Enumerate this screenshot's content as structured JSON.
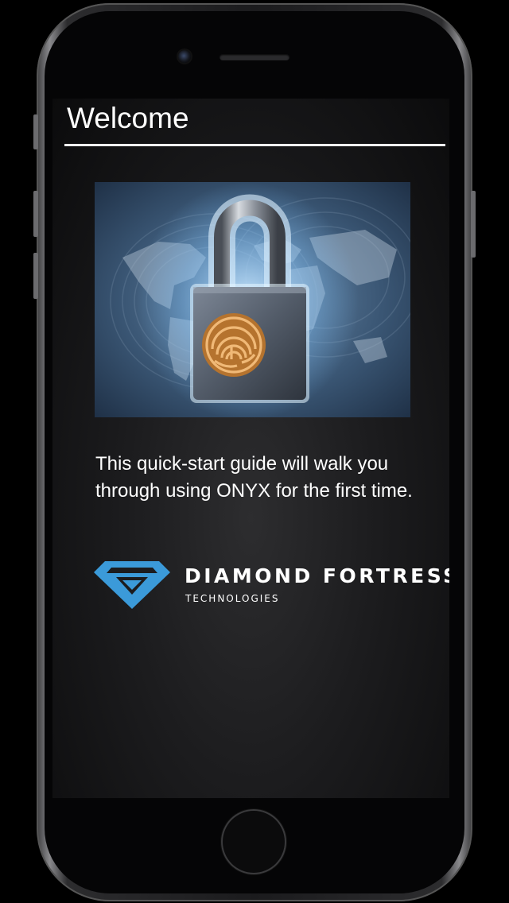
{
  "header": {
    "title": "Welcome"
  },
  "hero": {
    "image": "fingerprint-padlock-over-world-map"
  },
  "intro": {
    "text": "This quick-start guide will walk you through using ONYX for the first time."
  },
  "brand": {
    "name": "DIAMOND FORTRESS",
    "subtitle": "TECHNOLOGIES",
    "mark_icon": "diamond-logo-icon",
    "accent_color": "#3b9ad9"
  },
  "colors": {
    "background": "#1c1c1e",
    "text": "#ffffff",
    "lock_fingerprint": "#c98a3e"
  }
}
